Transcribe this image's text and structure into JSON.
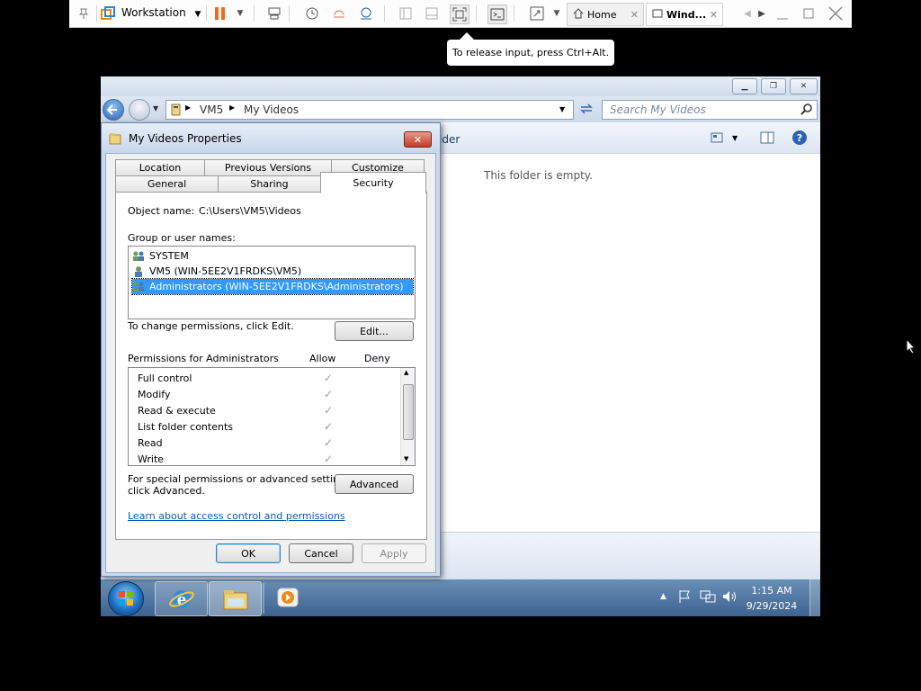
{
  "vmware": {
    "app_name": "Workstation",
    "tabs": [
      {
        "label": "Home"
      },
      {
        "label": "Wind..."
      }
    ],
    "tooltip": "To release input, press Ctrl+Alt."
  },
  "explorer": {
    "breadcrumb": [
      "VM5",
      "My Videos"
    ],
    "search_placeholder": "Search My Videos",
    "cmdbar_partial_text": "lder",
    "empty_message": "This folder is empty."
  },
  "dialog": {
    "title": "My Videos Properties",
    "tabs_row1": [
      "Location",
      "Previous Versions",
      "Customize"
    ],
    "tabs_row2": [
      "General",
      "Sharing",
      "Security"
    ],
    "active_tab": "Security",
    "object_name_label": "Object name:",
    "object_name_value": "C:\\Users\\VM5\\Videos",
    "group_label": "Group or user names:",
    "users": [
      {
        "name": "SYSTEM"
      },
      {
        "name": "VM5 (WIN-5EE2V1FRDKS\\VM5)"
      },
      {
        "name": "Administrators (WIN-5EE2V1FRDKS\\Administrators)"
      }
    ],
    "selected_user_index": 2,
    "change_hint": "To change permissions, click Edit.",
    "edit_button": "Edit...",
    "permissions_label": "Permissions for Administrators",
    "allow_header": "Allow",
    "deny_header": "Deny",
    "permissions": [
      {
        "name": "Full control",
        "allow": true,
        "deny": false
      },
      {
        "name": "Modify",
        "allow": true,
        "deny": false
      },
      {
        "name": "Read & execute",
        "allow": true,
        "deny": false
      },
      {
        "name": "List folder contents",
        "allow": true,
        "deny": false
      },
      {
        "name": "Read",
        "allow": true,
        "deny": false
      },
      {
        "name": "Write",
        "allow": true,
        "deny": false
      }
    ],
    "advanced_hint_line1": "For special permissions or advanced settings,",
    "advanced_hint_line2": "click Advanced.",
    "advanced_button": "Advanced",
    "learn_link": "Learn about access control and permissions",
    "ok_button": "OK",
    "cancel_button": "Cancel",
    "apply_button": "Apply"
  },
  "taskbar": {
    "time": "1:15 AM",
    "date": "9/29/2024"
  }
}
